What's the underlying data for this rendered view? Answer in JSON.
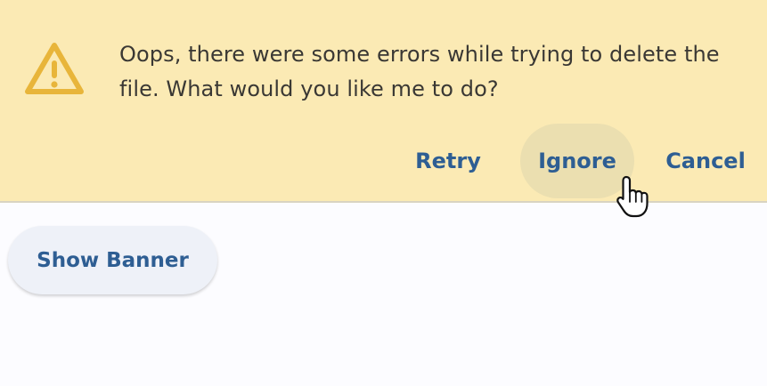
{
  "banner": {
    "icon": "warning-triangle-icon",
    "message": "Oops, there were some errors while trying to delete the file. What would you like me to do?",
    "actions": {
      "retry_label": "Retry",
      "ignore_label": "Ignore",
      "cancel_label": "Cancel"
    },
    "background_color": "#fbeab4",
    "icon_color": "#e8b53a",
    "action_color": "#2e5e93"
  },
  "main": {
    "show_banner_label": "Show Banner"
  },
  "cursor": {
    "icon": "hand-pointer-icon",
    "hovering": "Ignore"
  }
}
